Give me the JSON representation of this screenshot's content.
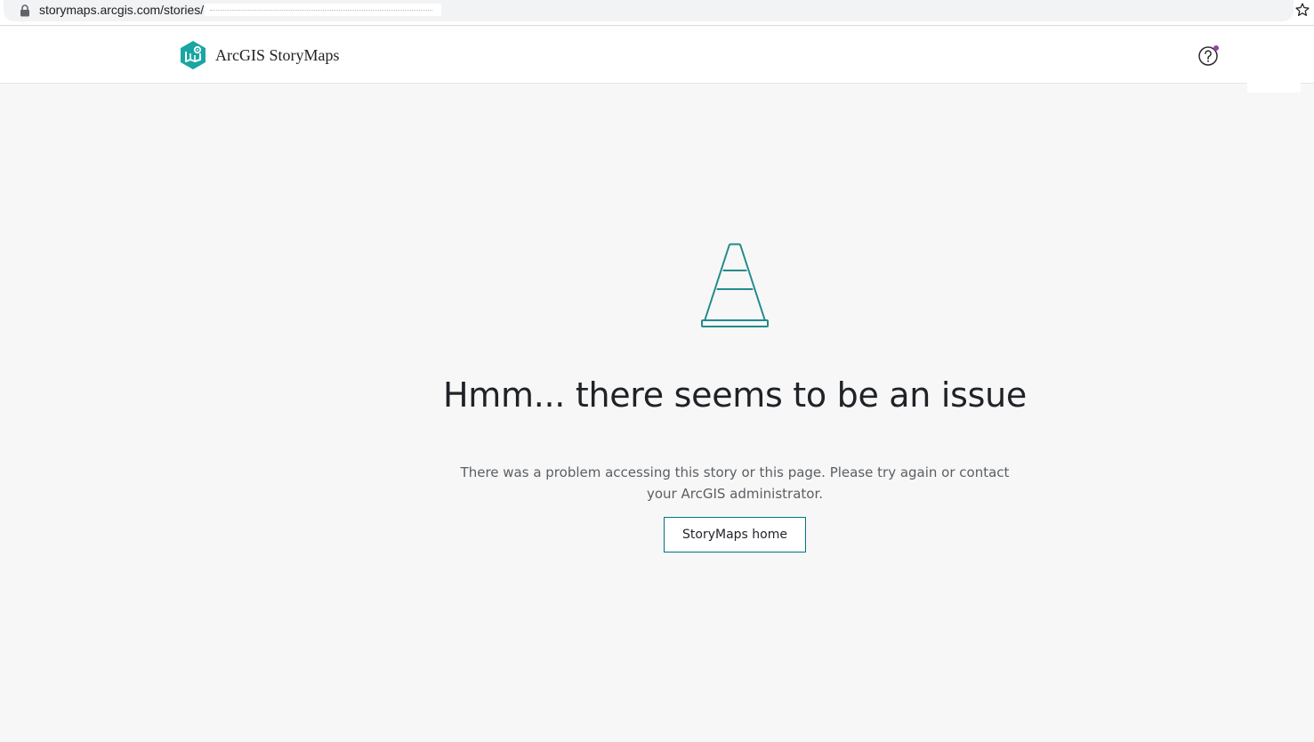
{
  "browser": {
    "url": "storymaps.arcgis.com/stories/",
    "icons": {
      "lock": "lock-icon",
      "bookmark": "star-icon"
    }
  },
  "header": {
    "brand_name": "ArcGIS StoryMaps",
    "icons": {
      "logo": "storymaps-logo-icon",
      "help": "help-icon"
    },
    "colors": {
      "logo": "#1aa6a3",
      "notification_dot": "#9b3fb4"
    }
  },
  "error": {
    "icon": "traffic-cone-icon",
    "title": "Hmm... there seems to be an issue",
    "message": "There was a problem accessing this story or this page. Please try again or contact your ArcGIS administrator.",
    "home_button_label": "StoryMaps home"
  },
  "colors": {
    "accent": "#007481",
    "background": "#f7f7f7",
    "text": "#1f2328",
    "muted_text": "#5a5f64"
  }
}
